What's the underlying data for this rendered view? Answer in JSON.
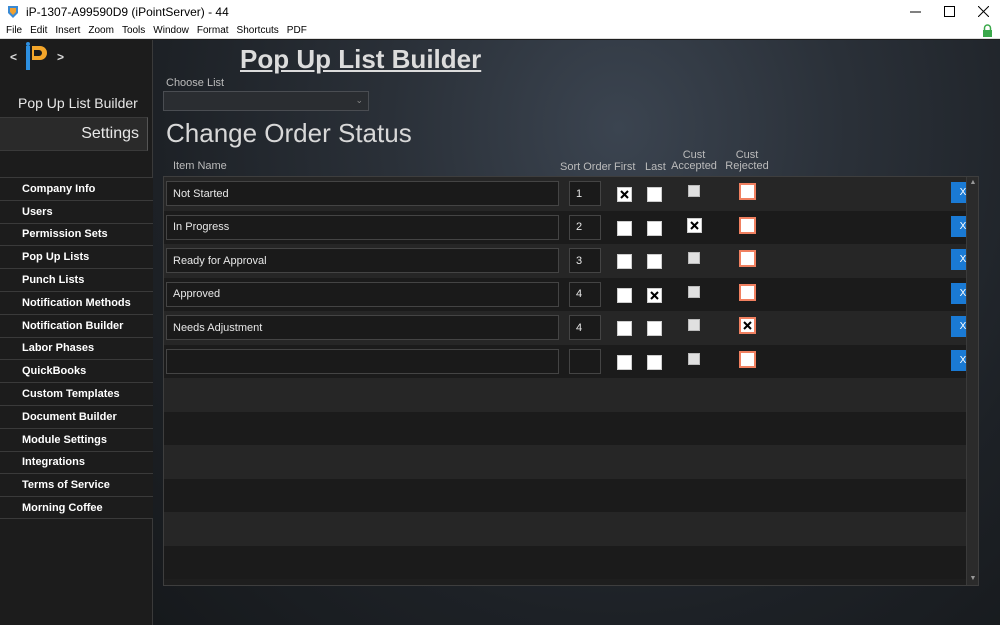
{
  "window": {
    "title": "iP-1307-A99590D9 (iPointServer) - 44",
    "minimize": "—",
    "maximize": "☐",
    "close": "✕"
  },
  "menu": [
    "File",
    "Edit",
    "Insert",
    "Zoom",
    "Tools",
    "Window",
    "Format",
    "Shortcuts",
    "PDF"
  ],
  "sidebar": {
    "prev": "<",
    "next": ">",
    "section_title": "Pop Up List Builder",
    "settings_label": "Settings",
    "items": [
      "Company Info",
      "Users",
      "Permission Sets",
      "Pop Up Lists",
      "Punch Lists",
      "Notification Methods",
      "Notification Builder",
      "Labor Phases",
      "QuickBooks",
      "Custom Templates",
      "Document Builder",
      "Module Settings",
      "Integrations",
      "Terms of Service",
      "Morning Coffee"
    ]
  },
  "main": {
    "page_title": "Pop Up List Builder",
    "choose_list_label": "Choose List",
    "choose_list_value": "",
    "list_title": "Change Order Status",
    "columns": {
      "item_name": "Item Name",
      "sort_order": "Sort Order",
      "first": "First",
      "last": "Last",
      "cust_accepted_1": "Cust",
      "cust_accepted_2": "Accepted",
      "cust_rejected_1": "Cust",
      "cust_rejected_2": "Rejected"
    },
    "delete_label": "X",
    "rows": [
      {
        "name": "Not Started",
        "sort": "1",
        "first": true,
        "last": false,
        "accepted": false,
        "rejected": false
      },
      {
        "name": "In Progress",
        "sort": "2",
        "first": false,
        "last": false,
        "accepted": true,
        "rejected": false
      },
      {
        "name": "Ready for Approval",
        "sort": "3",
        "first": false,
        "last": false,
        "accepted": false,
        "rejected": false
      },
      {
        "name": "Approved",
        "sort": "4",
        "first": false,
        "last": true,
        "accepted": false,
        "rejected": false
      },
      {
        "name": "Needs Adjustment",
        "sort": "4",
        "first": false,
        "last": false,
        "accepted": false,
        "rejected": true
      },
      {
        "name": "",
        "sort": "",
        "first": false,
        "last": false,
        "accepted": false,
        "rejected": false
      }
    ]
  },
  "colors": {
    "accent_blue": "#1a7ad4",
    "rejected_border": "#f08060",
    "lock_green": "#3aa84a"
  }
}
